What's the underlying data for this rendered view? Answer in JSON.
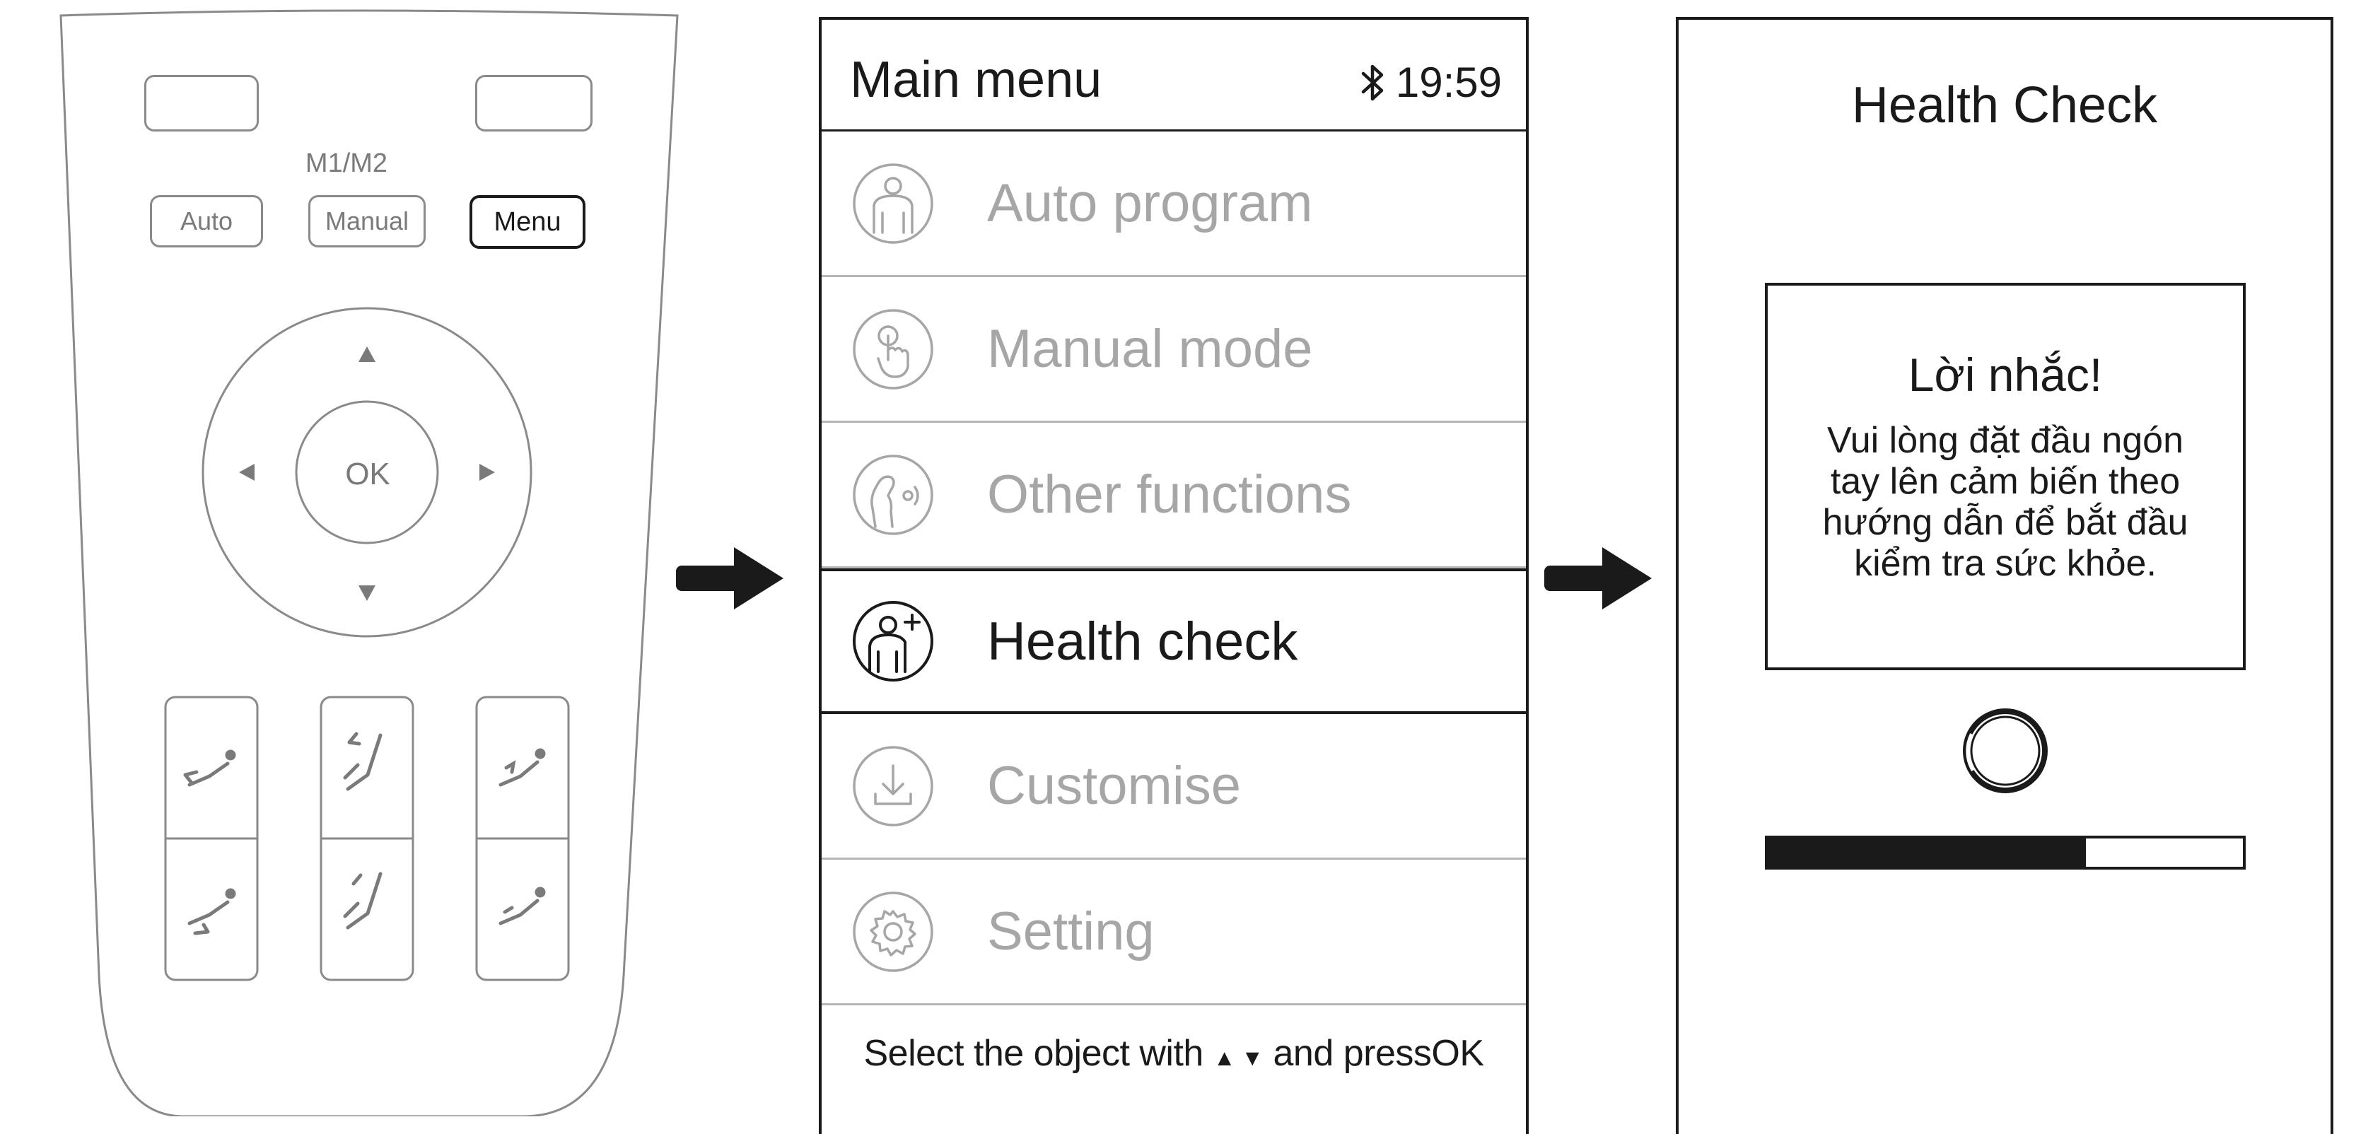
{
  "remote": {
    "buttons": {
      "power": {
        "icon": "power-icon"
      },
      "pause": {
        "icon": "pause-icon"
      },
      "auto_label": "Auto",
      "manual_label": "Manual",
      "menu_label": "Menu",
      "memory_label": "M1/M2",
      "ok_label": "OK"
    },
    "dpad_icons": [
      "arrow-up-icon",
      "arrow-down-icon",
      "arrow-left-icon",
      "arrow-right-icon"
    ],
    "recline_buttons": [
      "recline-back-up-icon",
      "recline-leg-up-icon",
      "recline-zero-gravity-icon",
      "recline-back-down-icon",
      "recline-leg-down-icon",
      "recline-zero-gravity-off-icon"
    ]
  },
  "arrows": [
    "flow-arrow-icon",
    "flow-arrow-icon"
  ],
  "main_menu": {
    "title": "Main menu",
    "status_icon": "bluetooth-icon",
    "time": "19:59",
    "items": [
      {
        "label": "Auto program",
        "icon": "person-icon",
        "selected": false
      },
      {
        "label": "Manual mode",
        "icon": "hand-pointer-icon",
        "selected": false
      },
      {
        "label": "Other functions",
        "icon": "person-vibration-icon",
        "selected": false
      },
      {
        "label": "Health check",
        "icon": "person-plus-icon",
        "selected": true
      },
      {
        "label": "Customise",
        "icon": "download-icon",
        "selected": false
      },
      {
        "label": "Setting",
        "icon": "gear-icon",
        "selected": false
      }
    ],
    "footer": {
      "prefix": "Select the object with",
      "arrows": "▲ ▼",
      "suffix": "and press",
      "ok": "OK"
    }
  },
  "health_check": {
    "title": "Health Check",
    "reminder_title": "Lời nhắc!",
    "reminder_lines": [
      "Vui lòng đặt đầu ngón",
      "tay lên cảm biến theo",
      "hướng dẫn để bắt đầu",
      "kiểm tra sức khỏe."
    ],
    "progress": 0.67,
    "spinner_icon": "loading-ring-icon"
  },
  "colors": {
    "ink": "#1a1a1a",
    "inactive_text": "#a6a6a6",
    "divider": "#b5b5b5",
    "remote_outline": "#8a8a8a"
  }
}
